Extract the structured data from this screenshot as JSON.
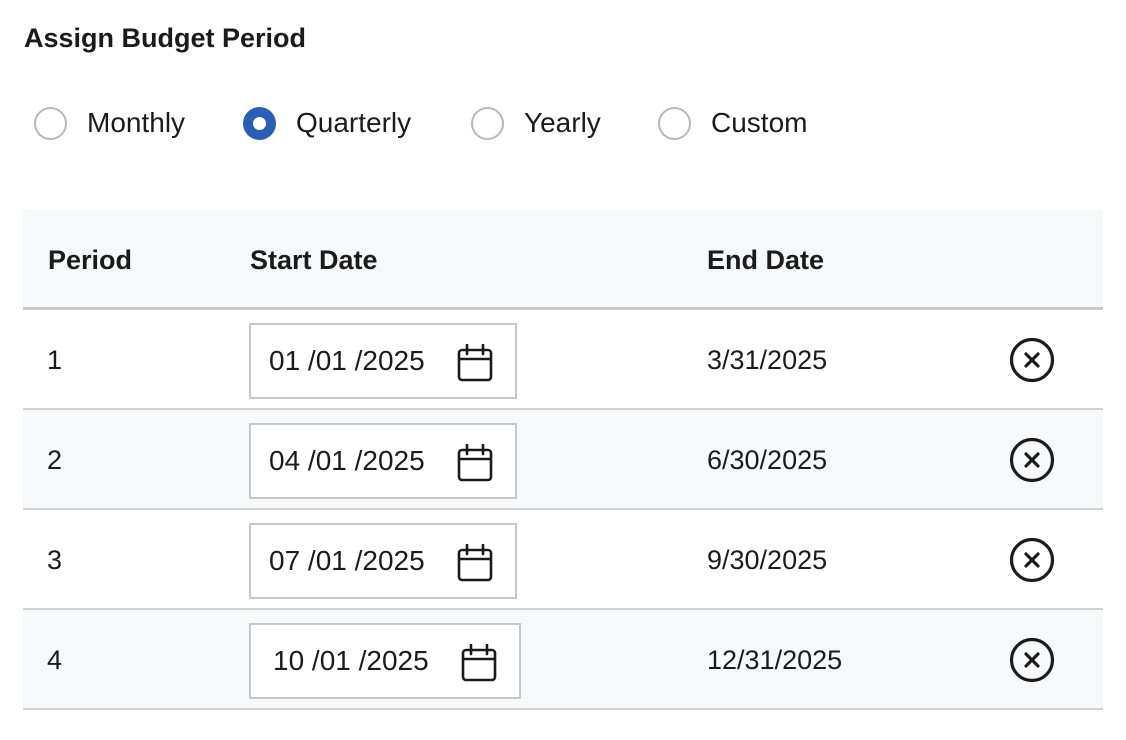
{
  "title": "Assign Budget Period",
  "period_options": [
    {
      "label": "Monthly",
      "checked": false
    },
    {
      "label": "Quarterly",
      "checked": true
    },
    {
      "label": "Yearly",
      "checked": false
    },
    {
      "label": "Custom",
      "checked": false
    }
  ],
  "table": {
    "headers": {
      "period": "Period",
      "start_date": "Start Date",
      "end_date": "End Date"
    },
    "rows": [
      {
        "period": "1",
        "start_date": "01 /01 /2025",
        "end_date": "3/31/2025"
      },
      {
        "period": "2",
        "start_date": "04 /01 /2025",
        "end_date": "6/30/2025"
      },
      {
        "period": "3",
        "start_date": "07 /01 /2025",
        "end_date": "9/30/2025"
      },
      {
        "period": "4",
        "start_date": "10 /01 /2025",
        "end_date": "12/31/2025"
      }
    ]
  },
  "icons": {
    "date_picker": "calendar-icon",
    "remove_row": "close-circle-icon"
  },
  "colors": {
    "accent": "#2a5fb4",
    "header_bg": "#f7f8fa",
    "border": "#c9c9c9"
  }
}
